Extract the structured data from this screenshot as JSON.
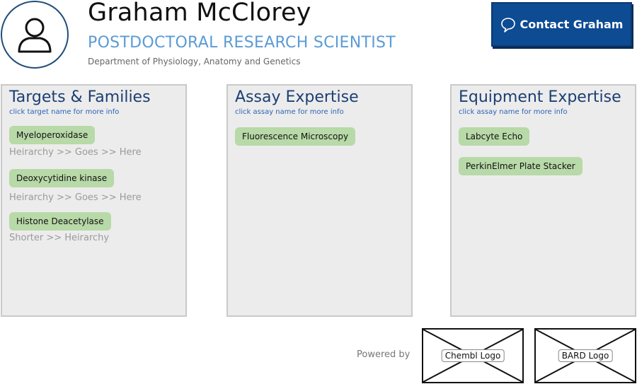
{
  "profile": {
    "name": "Graham McClorey",
    "title": "POSTDOCTORAL RESEARCH SCIENTIST",
    "department": "Department of Physiology, Anatomy and Genetics",
    "contact_label": "Contact Graham"
  },
  "panels": {
    "targets": {
      "heading": "Targets & Families",
      "hint": "click target name for more info",
      "items": [
        {
          "label": "Myeloperoxidase",
          "path": "Heirarchy >> Goes >> Here"
        },
        {
          "label": "Deoxycytidine kinase",
          "path": "Heirarchy >> Goes >> Here"
        },
        {
          "label": "Histone Deacetylase",
          "path": "Shorter >> Heirarchy"
        }
      ]
    },
    "assays": {
      "heading": "Assay Expertise",
      "hint": "click assay name for more info",
      "items": [
        {
          "label": "Fluorescence Microscopy"
        }
      ]
    },
    "equipment": {
      "heading": "Equipment Expertise",
      "hint": "click assay name for more info",
      "items": [
        {
          "label": "Labcyte Echo"
        },
        {
          "label": "PerkinElmer Plate Stacker"
        }
      ]
    }
  },
  "footer": {
    "powered_by": "Powered by",
    "logos": [
      {
        "label": "Chembl Logo"
      },
      {
        "label": "BARD Logo"
      }
    ]
  },
  "colors": {
    "brand": "#0d4b93",
    "chip": "#b8d9a8",
    "title": "#5b9bd5"
  }
}
